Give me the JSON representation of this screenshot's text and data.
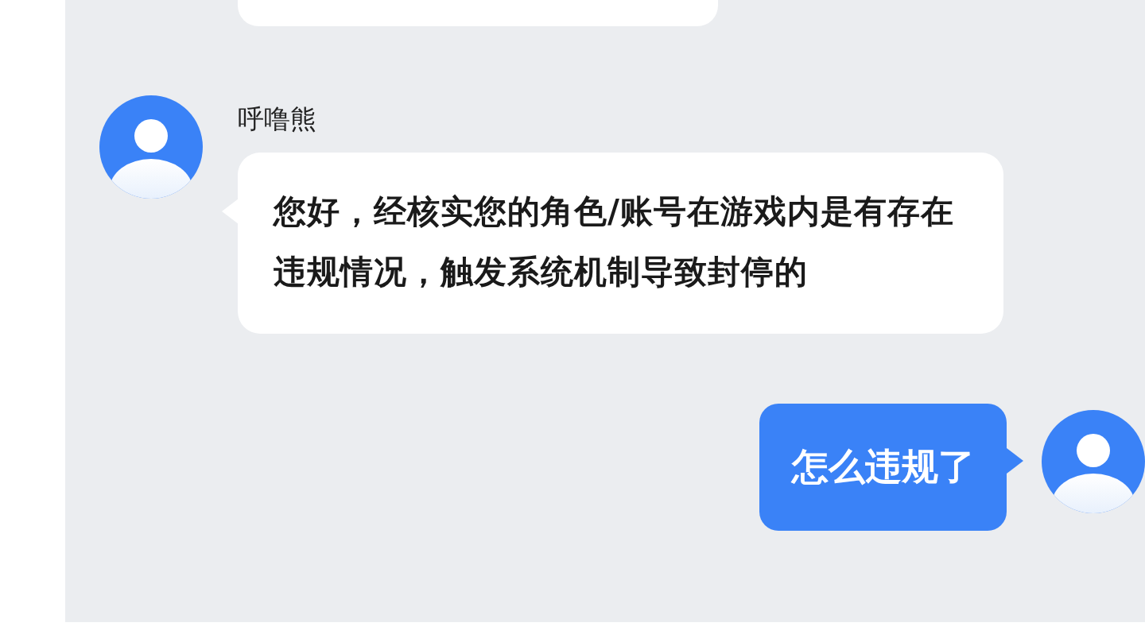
{
  "messages": [
    {
      "kind": "cut_off"
    },
    {
      "kind": "incoming",
      "sender": "呼噜熊",
      "text": "您好，经核实您的角色/账号在游戏内是有存在违规情况，触发系统机制导致封停的"
    },
    {
      "kind": "outgoing",
      "text": "怎么违规了"
    }
  ]
}
